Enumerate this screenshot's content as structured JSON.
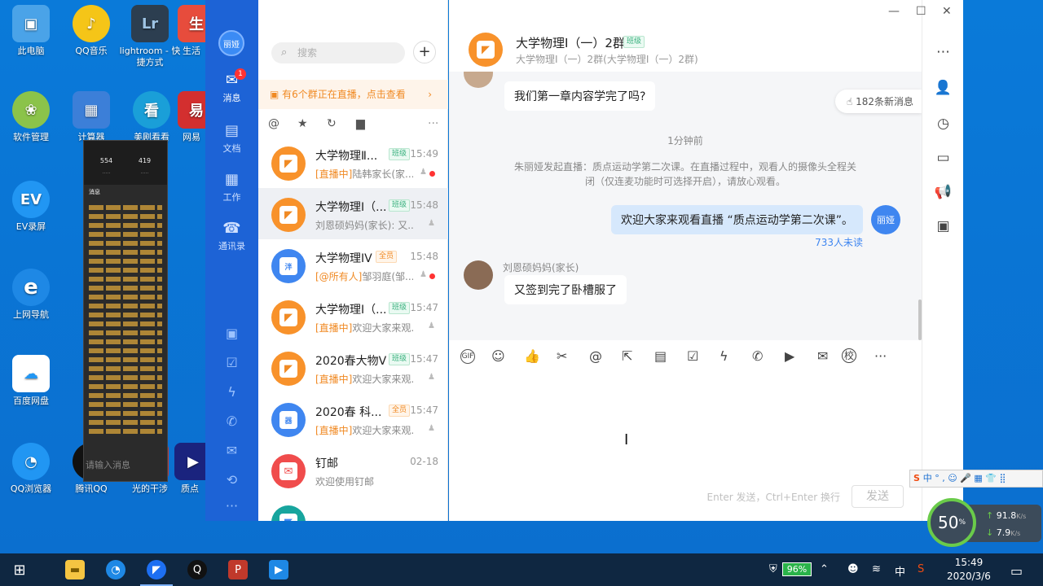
{
  "desktop": {
    "icons": [
      {
        "label": "此电脑",
        "icon": "computer-icon",
        "color": "#4aa3e8",
        "glyph": "▣"
      },
      {
        "label": "QQ音乐",
        "icon": "qqmusic-icon",
        "color": "#f5c518",
        "glyph": "♪"
      },
      {
        "label": "lightroom - 快捷方式",
        "icon": "lightroom-icon",
        "color": "#2c3e50",
        "glyph": "Lr"
      },
      {
        "label": "生活",
        "icon": "life-icon",
        "color": "#e74c3c",
        "glyph": "生"
      },
      {
        "label": "软件管理",
        "icon": "software-manager-icon",
        "color": "#8bc34a",
        "glyph": "❀"
      },
      {
        "label": "计算器",
        "icon": "calculator-icon",
        "color": "#3c7fd8",
        "glyph": "▦"
      },
      {
        "label": "美剧看看",
        "icon": "meiju-icon",
        "color": "#1a9fd8",
        "glyph": "看"
      },
      {
        "label": "网易",
        "icon": "netease-icon",
        "color": "#d32f2f",
        "glyph": "易"
      },
      {
        "label": "EV录屏",
        "icon": "ev-recorder-icon",
        "color": "#2196f3",
        "glyph": "EV"
      },
      {
        "label": "上网导航",
        "icon": "ie-icon",
        "color": "#1e88e5",
        "glyph": "e"
      },
      {
        "label": "百度网盘",
        "icon": "baidu-pan-icon",
        "color": "#2196f3",
        "glyph": "☁"
      },
      {
        "label": "QQ浏览器",
        "icon": "qq-browser-icon",
        "color": "#2196f3",
        "glyph": "◔"
      },
      {
        "label": "腾讯QQ",
        "icon": "qq-icon",
        "color": "#111111",
        "glyph": "Q"
      },
      {
        "label": "光的干涉",
        "icon": "ppt-icon",
        "color": "#c0392b",
        "glyph": "P"
      },
      {
        "label": "质点",
        "icon": "video-icon",
        "color": "#1a237e",
        "glyph": "▶"
      }
    ]
  },
  "floating_panel": {
    "stat1_value": "554",
    "stat2_value": "419",
    "title": "消息",
    "input_placeholder": "请输入消息"
  },
  "rail": {
    "avatar": "丽娅",
    "nav": [
      {
        "label": "消息",
        "glyph": "✉",
        "icon": "message-icon",
        "badge": "1"
      },
      {
        "label": "文档",
        "glyph": "▤",
        "icon": "document-icon"
      },
      {
        "label": "工作",
        "glyph": "▦",
        "icon": "work-icon"
      },
      {
        "label": "通讯录",
        "glyph": "☎",
        "icon": "contacts-icon"
      }
    ]
  },
  "list": {
    "search_placeholder": "搜索",
    "add_button": "+",
    "live_banner": "有6个群正在直播，点击查看",
    "conversations": [
      {
        "name": "大学物理Ⅱ...",
        "tag": "班级",
        "time": "15:49",
        "preview_prefix": "[直播中]",
        "preview": "陆韩家长(家...",
        "dot": true
      },
      {
        "name": "大学物理I（...",
        "tag": "班级",
        "time": "15:48",
        "preview_prefix": "",
        "preview": "刘恩硕妈妈(家长): 又...",
        "dot": false
      },
      {
        "name": "大学物理IV",
        "tag": "全员",
        "time": "15:48",
        "preview_prefix": "[@所有人]",
        "preview": "邹羽庭(邹...",
        "dot": true
      },
      {
        "name": "大学物理I（...",
        "tag": "班级",
        "time": "15:47",
        "preview_prefix": "[直播中]",
        "preview": "欢迎大家来观...",
        "dot": false
      },
      {
        "name": "2020春大物V",
        "tag": "班级",
        "time": "15:47",
        "preview_prefix": "[直播中]",
        "preview": "欢迎大家来观...",
        "dot": false
      },
      {
        "name": "2020春 科...",
        "tag": "全员",
        "time": "15:47",
        "preview_prefix": "[直播中]",
        "preview": "欢迎大家来观...",
        "dot": false
      },
      {
        "name": "钉邮",
        "tag": "",
        "time": "02-18",
        "preview_prefix": "",
        "preview": "欢迎使用钉邮",
        "dot": false
      }
    ]
  },
  "chat": {
    "title": "大学物理I（一）2群",
    "title_tag": "班级",
    "subtitle": "大学物理I（一）2群(大学物理I（一）2群)",
    "messages": {
      "top_bubble": "我们第一章内容学完了吗?",
      "new_messages": "182条新消息",
      "time_divider": "1分钟前",
      "system_note": "朱丽娅发起直播：质点运动学第二次课。在直播过程中，观看人的摄像头全程关闭（仅连麦功能时可选择开启），请放心观看。",
      "my_bubble": "欢迎大家来观看直播 “质点运动学第二次课”。",
      "my_avatar": "丽娅",
      "unread": "733人未读",
      "sender": "刘恩硕妈妈(家长)",
      "last_bubble": "又签到完了卧槽服了"
    },
    "compose_hint": "Enter 发送，Ctrl+Enter 换行",
    "send_label": "发送"
  },
  "ime_bar": "中 ° , ☺ 🎤 ▦ 👕 ⣿",
  "network": {
    "percent": "50",
    "up": "91.8",
    "down": "7.9",
    "unit": "K/s"
  },
  "taskbar": {
    "battery": "96%",
    "ime": "中",
    "time": "15:49",
    "date": "2020/3/6"
  }
}
